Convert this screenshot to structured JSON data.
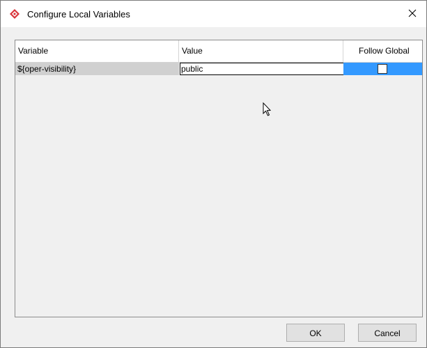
{
  "window": {
    "title": "Configure Local Variables",
    "icons": {
      "app": "visual-paradigm-logo-icon",
      "close": "close-icon"
    }
  },
  "table": {
    "columns": [
      "Variable",
      "Value",
      "Follow Global"
    ],
    "rows": [
      {
        "variable": "${oper-visibility}",
        "value": "public",
        "follow_global": false
      }
    ]
  },
  "buttons": {
    "ok": "OK",
    "cancel": "Cancel"
  },
  "colors": {
    "selection": "#3399ff",
    "variable_cell": "#d0d0d0",
    "app_icon": "#d9343a"
  }
}
